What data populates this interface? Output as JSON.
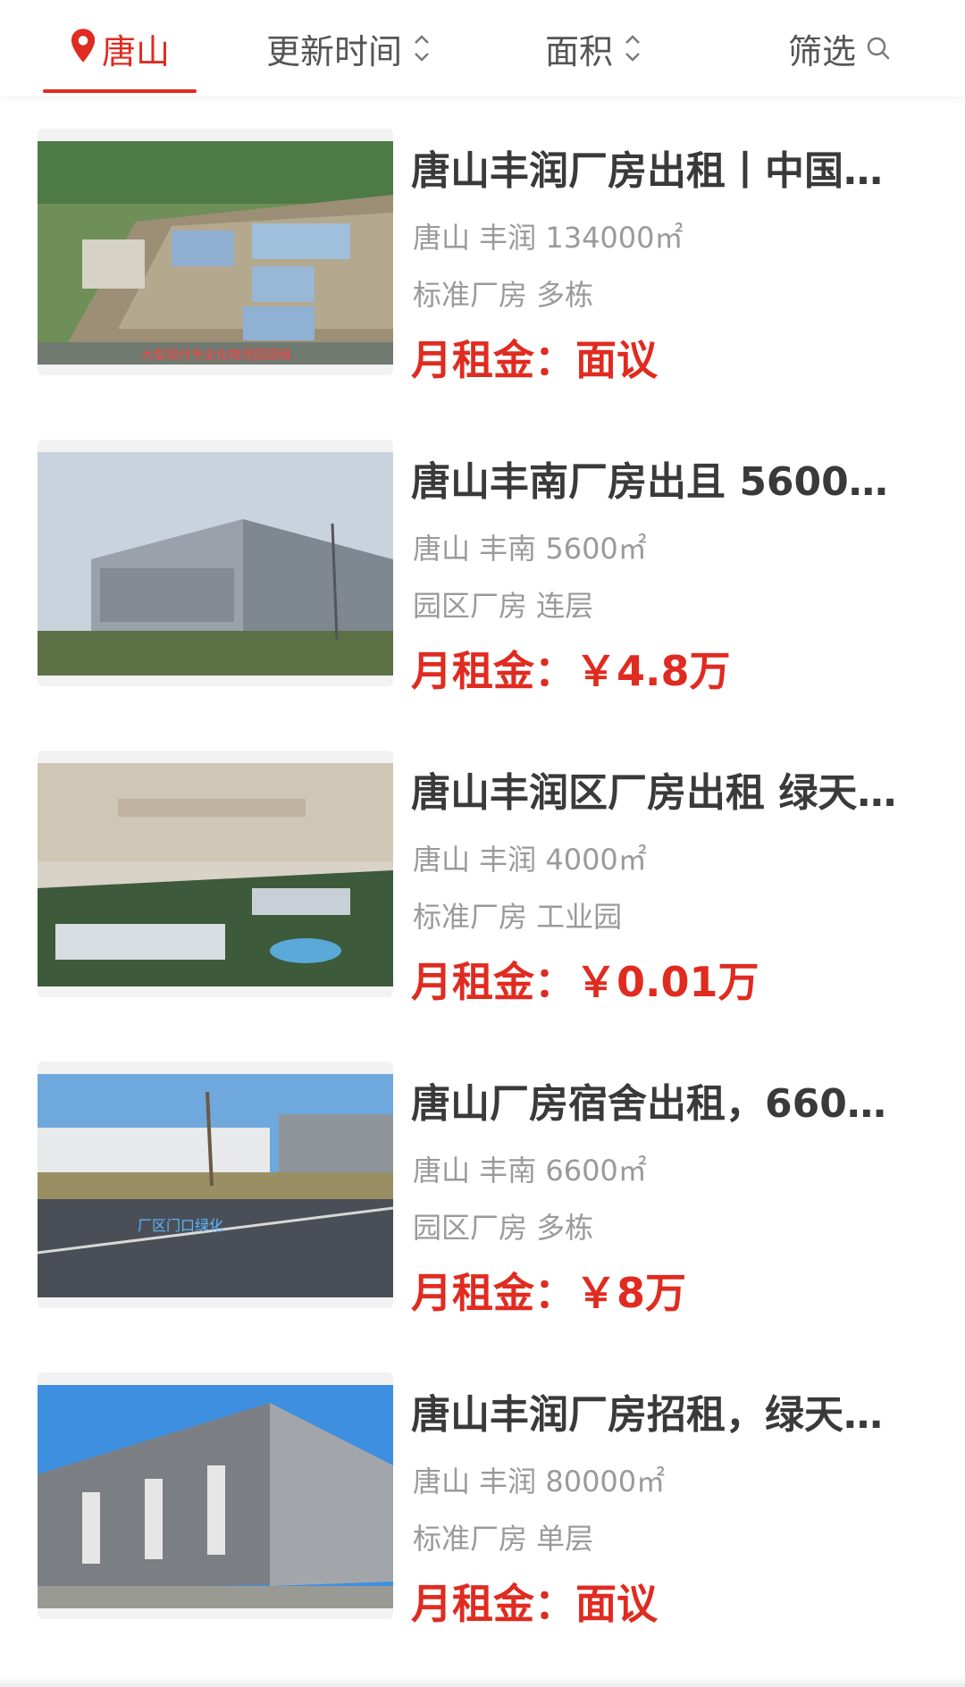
{
  "filter_bar": {
    "city_label": "唐山",
    "update_time_label": "更新时间",
    "area_label": "面积",
    "filter_label": "筛选",
    "accent_color": "#e02b20"
  },
  "listings": [
    {
      "title": "唐山丰润厂房出租丨中国…",
      "location": "唐山 丰润 134000㎡",
      "tags": "标准厂房 多栋",
      "price": "月租金：面议",
      "image_caption": "大型现代专业化物流园招租"
    },
    {
      "title": "唐山丰南厂房出且 5600平…",
      "location": "唐山 丰南 5600㎡",
      "tags": "园区厂房 连层",
      "price": "月租金：￥4.8万"
    },
    {
      "title": "唐山丰润区厂房出租 绿天…",
      "location": "唐山 丰润 4000㎡",
      "tags": "标准厂房 工业园",
      "price": "月租金：￥0.01万"
    },
    {
      "title": "唐山厂房宿舍出租，6600…",
      "location": "唐山 丰南 6600㎡",
      "tags": "园区厂房 多栋",
      "price": "月租金：￥8万",
      "image_caption": "厂区门口绿化"
    },
    {
      "title": "唐山丰润厂房招租，绿天…",
      "location": "唐山 丰润 80000㎡",
      "tags": "标准厂房 单层",
      "price": "月租金：面议"
    }
  ]
}
